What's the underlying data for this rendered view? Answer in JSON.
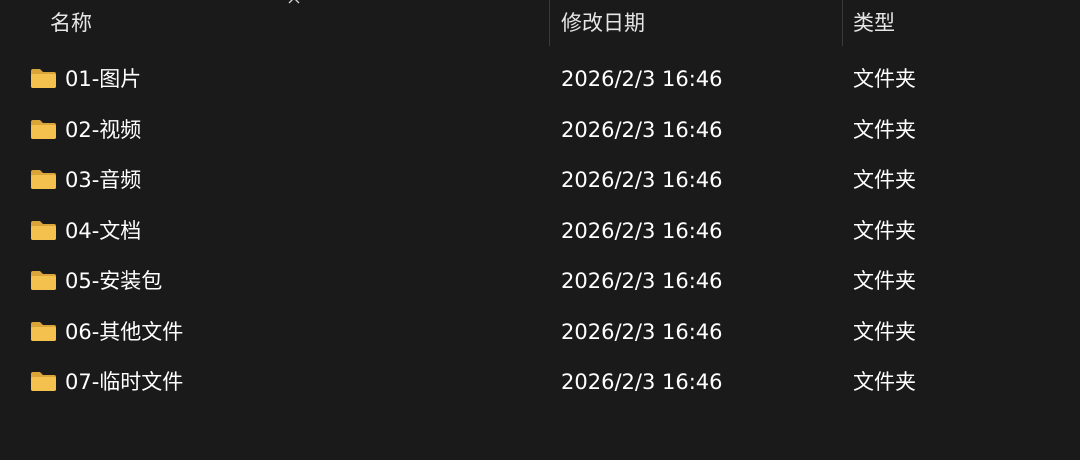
{
  "columns": {
    "name": "名称",
    "modified": "修改日期",
    "type": "类型"
  },
  "sort": {
    "column": "name",
    "direction": "ascending",
    "icon": "sort-up-chevron-icon"
  },
  "accent": {
    "folder": "#f4c04e",
    "folder_dark": "#d9a53a",
    "background": "#1a1a1a",
    "divider": "#3a3a3a"
  },
  "rows": [
    {
      "icon": "folder-icon",
      "name": "01-图片",
      "modified": "2026/2/3 16:46",
      "type": "文件夹"
    },
    {
      "icon": "folder-icon",
      "name": "02-视频",
      "modified": "2026/2/3 16:46",
      "type": "文件夹"
    },
    {
      "icon": "folder-icon",
      "name": "03-音频",
      "modified": "2026/2/3 16:46",
      "type": "文件夹"
    },
    {
      "icon": "folder-icon",
      "name": "04-文档",
      "modified": "2026/2/3 16:46",
      "type": "文件夹"
    },
    {
      "icon": "folder-icon",
      "name": "05-安装包",
      "modified": "2026/2/3 16:46",
      "type": "文件夹"
    },
    {
      "icon": "folder-icon",
      "name": "06-其他文件",
      "modified": "2026/2/3 16:46",
      "type": "文件夹"
    },
    {
      "icon": "folder-icon",
      "name": "07-临时文件",
      "modified": "2026/2/3 16:46",
      "type": "文件夹"
    }
  ]
}
